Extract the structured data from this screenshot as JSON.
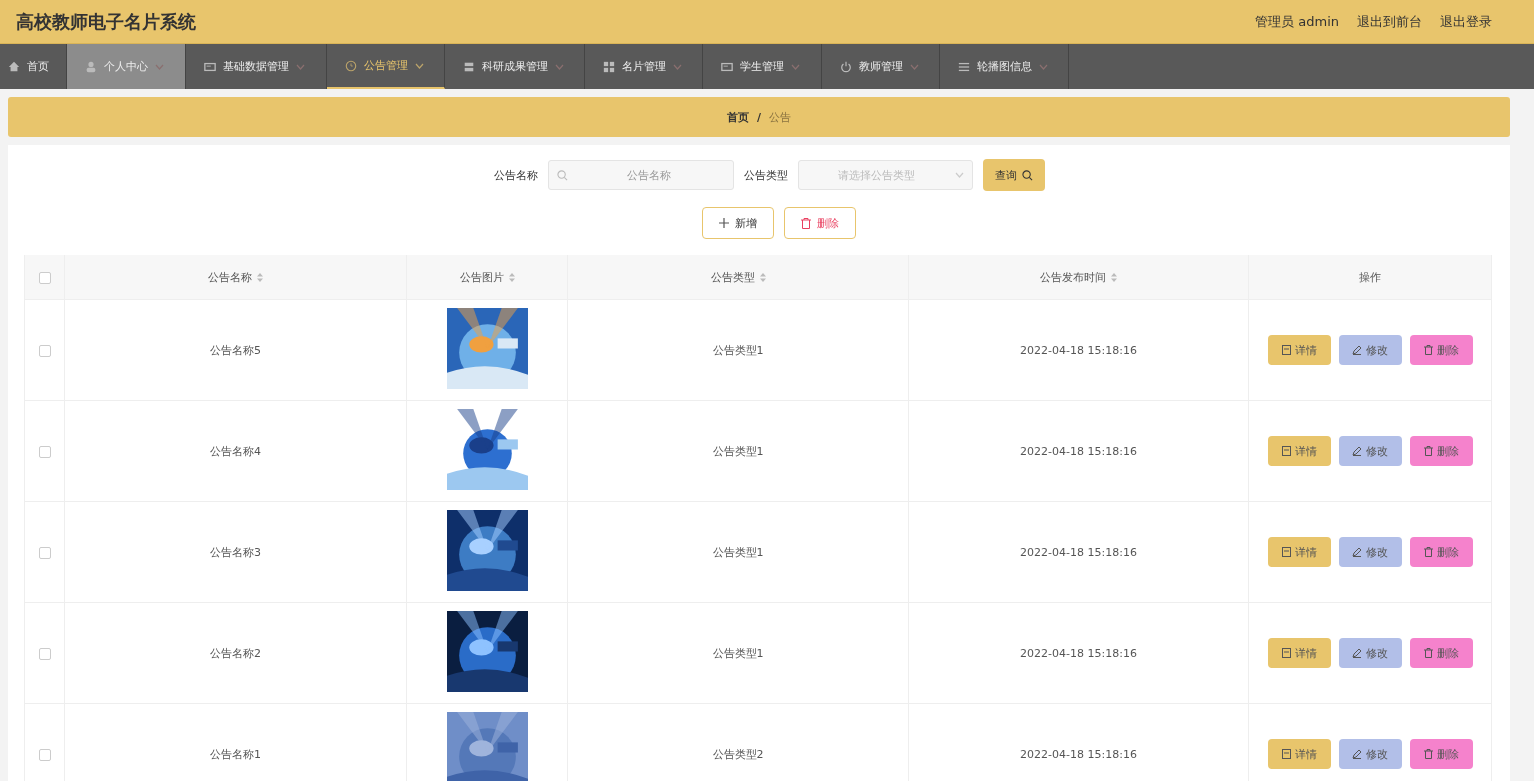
{
  "header": {
    "title": "高校教师电子名片系统",
    "links": [
      "管理员 admin",
      "退出到前台",
      "退出登录"
    ]
  },
  "nav": [
    {
      "label": "首页",
      "has_menu": false,
      "selected": false,
      "highlighted": false
    },
    {
      "label": "个人中心",
      "has_menu": true,
      "selected": false,
      "highlighted": true
    },
    {
      "label": "基础数据管理",
      "has_menu": true,
      "selected": false,
      "highlighted": false
    },
    {
      "label": "公告管理",
      "has_menu": true,
      "selected": true,
      "highlighted": false
    },
    {
      "label": "科研成果管理",
      "has_menu": true,
      "selected": false,
      "highlighted": false
    },
    {
      "label": "名片管理",
      "has_menu": true,
      "selected": false,
      "highlighted": false
    },
    {
      "label": "学生管理",
      "has_menu": true,
      "selected": false,
      "highlighted": false
    },
    {
      "label": "教师管理",
      "has_menu": true,
      "selected": false,
      "highlighted": false
    },
    {
      "label": "轮播图信息",
      "has_menu": true,
      "selected": false,
      "highlighted": false
    }
  ],
  "breadcrumb": {
    "items": [
      "首页",
      "公告"
    ],
    "separator": "/"
  },
  "search": {
    "name_label": "公告名称",
    "name_placeholder": "公告名称",
    "type_label": "公告类型",
    "type_placeholder": "请选择公告类型",
    "button": "查询"
  },
  "actions": [
    {
      "label": "新增",
      "kind": "add"
    },
    {
      "label": "删除",
      "kind": "delete"
    }
  ],
  "table": {
    "all_checked": false,
    "columns": [
      "公告名称",
      "公告图片",
      "公告类型",
      "公告发布时间",
      "操作"
    ],
    "rows": [
      {
        "name": "公告名称5",
        "type": "公告类型1",
        "time": "2022-04-18 15:18:16",
        "checked": false,
        "buttons": [
          "详情",
          "修改",
          "删除"
        ]
      },
      {
        "name": "公告名称4",
        "type": "公告类型1",
        "time": "2022-04-18 15:18:16",
        "checked": false,
        "buttons": [
          "详情",
          "修改",
          "删除"
        ]
      },
      {
        "name": "公告名称3",
        "type": "公告类型1",
        "time": "2022-04-18 15:18:16",
        "checked": false,
        "buttons": [
          "详情",
          "修改",
          "删除"
        ]
      },
      {
        "name": "公告名称2",
        "type": "公告类型1",
        "time": "2022-04-18 15:18:16",
        "checked": false,
        "buttons": [
          "详情",
          "修改",
          "删除"
        ]
      },
      {
        "name": "公告名称1",
        "type": "公告类型2",
        "time": "2022-04-18 15:18:16",
        "checked": false,
        "buttons": [
          "详情",
          "修改",
          "删除"
        ]
      }
    ]
  }
}
